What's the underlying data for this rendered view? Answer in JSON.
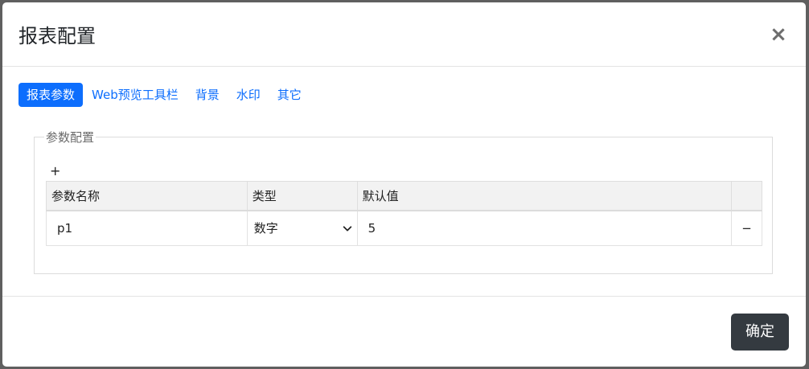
{
  "dialog": {
    "title": "报表配置",
    "close_symbol": "×"
  },
  "tabs": [
    {
      "label": "报表参数",
      "active": true
    },
    {
      "label": "Web预览工具栏",
      "active": false
    },
    {
      "label": "背景",
      "active": false
    },
    {
      "label": "水印",
      "active": false
    },
    {
      "label": "其它",
      "active": false
    }
  ],
  "param_config": {
    "legend": "参数配置",
    "add_symbol": "+",
    "columns": [
      "参数名称",
      "类型",
      "默认值",
      ""
    ],
    "rows": [
      {
        "name": "p1",
        "type": "数字",
        "default_value": "5",
        "remove_symbol": "−"
      }
    ]
  },
  "footer": {
    "ok_label": "确定"
  },
  "colors": {
    "accent": "#0d6efd",
    "ok_button": "#343a40",
    "overlay": "#5f5f5f"
  }
}
